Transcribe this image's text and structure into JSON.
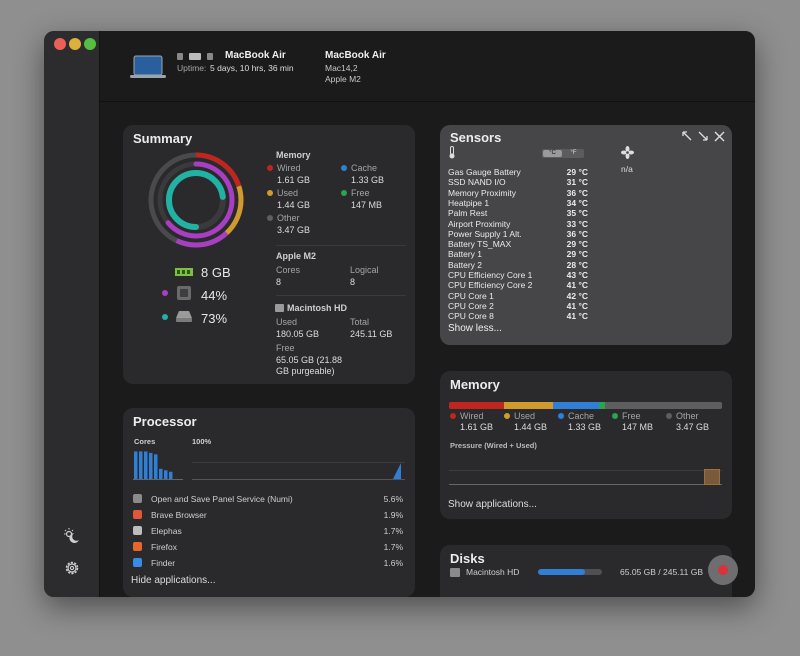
{
  "colors": {
    "wired": "#c0261d",
    "used": "#d19a2c",
    "cache": "#2f7fd6",
    "free": "#2aa355",
    "other": "#5e5e5e",
    "purple": "#a83ec2",
    "teal": "#22b2a3"
  },
  "header": {
    "device_name": "MacBook Air",
    "uptime_label": "Uptime:",
    "uptime_value": "5 days, 10 hrs, 36 min",
    "model_name": "MacBook Air",
    "model_id": "Mac14,2",
    "chip": "Apple M2"
  },
  "summary": {
    "title": "Summary",
    "memory_label": "8 GB",
    "cpu_pct": "44%",
    "disk_pct": "73%",
    "ring_fractions": {
      "memory": 0.57,
      "cpu": 0.44,
      "disk": 0.73
    },
    "memory": {
      "title": "Memory",
      "wired_label": "Wired",
      "wired_value": "1.61 GB",
      "cache_label": "Cache",
      "cache_value": "1.33 GB",
      "used_label": "Used",
      "used_value": "1.44 GB",
      "free_label": "Free",
      "free_value": "147 MB",
      "other_label": "Other",
      "other_value": "3.47 GB"
    },
    "chip": {
      "title": "Apple M2",
      "cores_label": "Cores",
      "cores_value": "8",
      "logical_label": "Logical",
      "logical_value": "8"
    },
    "disk": {
      "title": "Macintosh HD",
      "used_label": "Used",
      "used_value": "180.05 GB",
      "total_label": "Total",
      "total_value": "245.11 GB",
      "free_label": "Free",
      "free_value": "65.05 GB (21.88 GB purgeable)"
    }
  },
  "processor": {
    "title": "Processor",
    "cores_label": "Cores",
    "pct_label": "100%",
    "core_bars": [
      0.95,
      0.95,
      0.95,
      0.9,
      0.85,
      0.35,
      0.3,
      0.25
    ],
    "apps": [
      {
        "name": "Open and Save Panel Service (Numi)",
        "pct": "5.6%",
        "icon": "shield-icon",
        "color": "#8b8b8b"
      },
      {
        "name": "Brave Browser",
        "pct": "1.9%",
        "icon": "brave-icon",
        "color": "#e0583a"
      },
      {
        "name": "Elephas",
        "pct": "1.7%",
        "icon": "elephas-icon",
        "color": "#bdbdbd"
      },
      {
        "name": "Firefox",
        "pct": "1.7%",
        "icon": "firefox-icon",
        "color": "#e8662c"
      },
      {
        "name": "Finder",
        "pct": "1.6%",
        "icon": "finder-icon",
        "color": "#3a8be6"
      }
    ],
    "hide_label": "Hide applications..."
  },
  "sensors": {
    "title": "Sensors",
    "unit_c": "°C",
    "unit_f": "°F",
    "fan_value": "n/a",
    "rows": [
      {
        "name": "Gas Gauge Battery",
        "value": "29 °C"
      },
      {
        "name": "SSD NAND I/O",
        "value": "31 °C"
      },
      {
        "name": "Memory Proximity",
        "value": "36 °C"
      },
      {
        "name": "Heatpipe 1",
        "value": "34 °C"
      },
      {
        "name": "Palm Rest",
        "value": "35 °C"
      },
      {
        "name": "Airport Proximity",
        "value": "33 °C"
      },
      {
        "name": "Power Supply 1 Alt.",
        "value": "36 °C"
      },
      {
        "name": "Battery TS_MAX",
        "value": "29 °C"
      },
      {
        "name": "Battery 1",
        "value": "29 °C"
      },
      {
        "name": "Battery 2",
        "value": "28 °C"
      },
      {
        "name": "CPU Efficiency Core 1",
        "value": "43 °C"
      },
      {
        "name": "CPU Efficiency Core 2",
        "value": "41 °C"
      },
      {
        "name": "CPU Core 1",
        "value": "42 °C"
      },
      {
        "name": "CPU Core 2",
        "value": "41 °C"
      },
      {
        "name": "CPU Core 8",
        "value": "41 °C"
      }
    ],
    "show_less": "Show less..."
  },
  "memory_card": {
    "title": "Memory",
    "bar_fractions": {
      "wired": 0.2,
      "used": 0.18,
      "cache": 0.17,
      "free": 0.02,
      "other": 0.43
    },
    "wired_label": "Wired",
    "wired_value": "1.61 GB",
    "used_label": "Used",
    "used_value": "1.44 GB",
    "cache_label": "Cache",
    "cache_value": "1.33 GB",
    "free_label": "Free",
    "free_value": "147 MB",
    "other_label": "Other",
    "other_value": "3.47 GB",
    "pressure_label": "Pressure (Wired + Used)",
    "show_apps": "Show applications..."
  },
  "disks": {
    "title": "Disks",
    "disk_name": "Macintosh HD",
    "usage_fraction": 0.73,
    "usage_text": "65.05 GB / 245.11 GB"
  }
}
